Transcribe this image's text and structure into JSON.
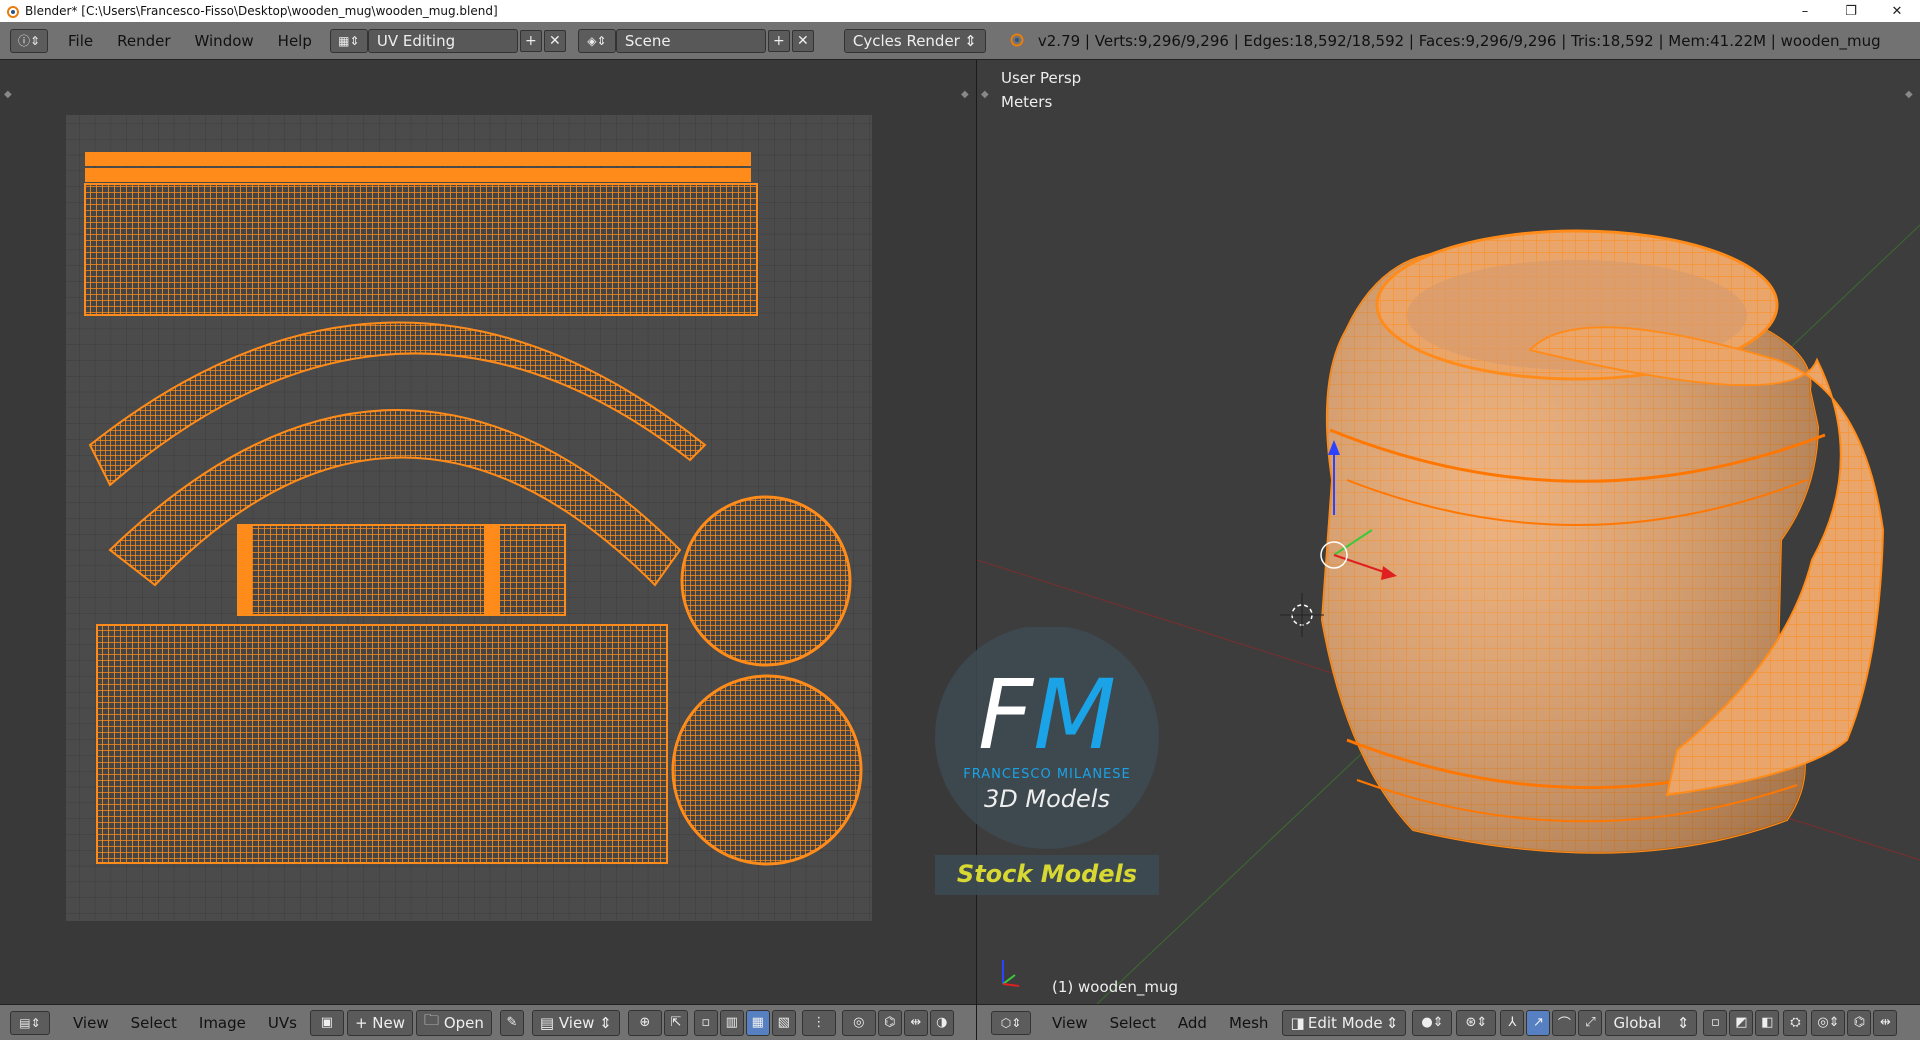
{
  "window": {
    "title": "Blender* [C:\\Users\\Francesco-Fisso\\Desktop\\wooden_mug\\wooden_mug.blend]"
  },
  "infobar": {
    "menus": [
      "File",
      "Render",
      "Window",
      "Help"
    ],
    "layout": "UV Editing",
    "scene": "Scene",
    "engine": "Cycles Render",
    "stats": "v2.79 | Verts:9,296/9,296 | Edges:18,592/18,592 | Faces:9,296/9,296 | Tris:18,592 | Mem:41.22M | wooden_mug"
  },
  "uv_header": {
    "menus": [
      "View",
      "Select",
      "Image",
      "UVs"
    ],
    "new": "New",
    "open": "Open",
    "view": "View"
  },
  "viewport": {
    "persp": "User Persp",
    "units": "Meters",
    "object": "(1) wooden_mug"
  },
  "view3d_header": {
    "menus": [
      "View",
      "Select",
      "Add",
      "Mesh"
    ],
    "mode": "Edit Mode",
    "orientation": "Global"
  },
  "watermark": {
    "initials": "FM",
    "name": "FRANCESCO MILANESE",
    "subtitle": "3D Models",
    "banner": "Stock Models"
  },
  "colors": {
    "wire": "#ff8c1a",
    "mesh": "#e8a060",
    "selected_edge": "#ff7700"
  }
}
